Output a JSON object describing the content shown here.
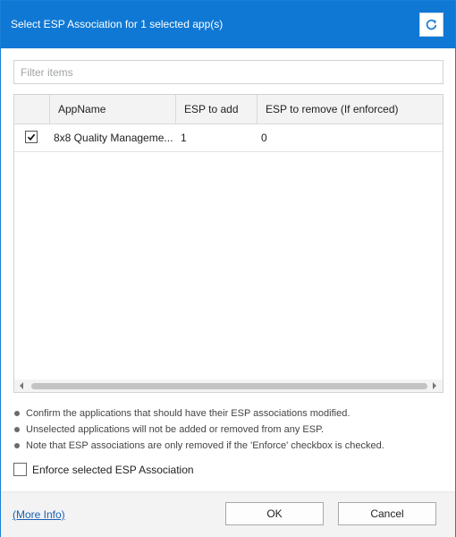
{
  "dialog": {
    "title": "Select ESP Association for 1 selected app(s)",
    "accent_color": "#0f78d4"
  },
  "toolbar": {
    "refresh_icon": "refresh-icon"
  },
  "filter": {
    "placeholder": "Filter items",
    "value": ""
  },
  "grid": {
    "columns": [
      "",
      "AppName",
      "ESP to add",
      "ESP to remove (If enforced)"
    ],
    "rows": [
      {
        "checked": true,
        "app_name": "8x8 Quality Manageme...",
        "esp_to_add": "1",
        "esp_to_remove": "0"
      }
    ]
  },
  "notes": [
    "Confirm the applications that should have their ESP associations modified.",
    "Unselected applications will not be added or removed from any ESP.",
    "Note that ESP associations are only removed if the 'Enforce' checkbox is checked."
  ],
  "enforce": {
    "label": "Enforce selected ESP Association",
    "checked": false
  },
  "footer": {
    "more_info": "(More Info)",
    "ok_label": "OK",
    "cancel_label": "Cancel"
  }
}
